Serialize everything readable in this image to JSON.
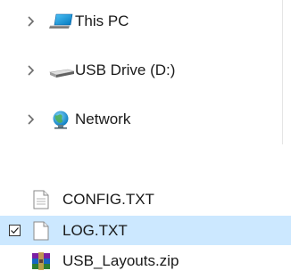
{
  "nav_pane": {
    "items": [
      {
        "label": "This PC",
        "icon": "this-pc-icon"
      },
      {
        "label": "USB Drive (D:)",
        "icon": "usb-drive-icon"
      },
      {
        "label": "Network",
        "icon": "network-icon"
      }
    ]
  },
  "file_list": {
    "items": [
      {
        "label": "CONFIG.TXT",
        "icon": "text-file-icon",
        "selected": false
      },
      {
        "label": "LOG.TXT",
        "icon": "text-file-icon",
        "selected": true,
        "checked": true
      },
      {
        "label": "USB_Layouts.zip",
        "icon": "zip-archive-icon",
        "selected": false
      }
    ]
  },
  "colors": {
    "selection": "#cce8ff",
    "chevron": "#6b6b6b",
    "text": "#1a1a1a"
  }
}
